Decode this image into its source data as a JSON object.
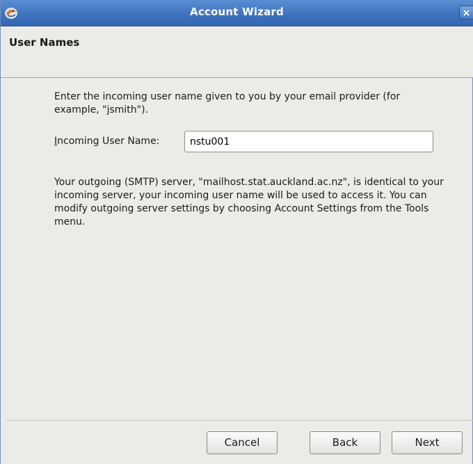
{
  "window": {
    "title": "Account Wizard",
    "close_glyph": "×",
    "app_icon": "thunderbird-icon"
  },
  "page": {
    "title": "User Names"
  },
  "form": {
    "intro_text": "Enter the incoming user name given to you by your email provider (for example, \"jsmith\").",
    "username_label_mnemonic": "I",
    "username_label_rest": "ncoming User Name:",
    "username_value": "nstu001",
    "outgoing_text": "Your outgoing (SMTP) server, \"mailhost.stat.auckland.ac.nz\", is identical to your incoming server, your incoming user name will be used to access it. You can modify outgoing server settings by choosing Account Settings from the Tools menu."
  },
  "buttons": {
    "cancel_label": "Cancel",
    "back_label": "Back",
    "next_label": "Next"
  },
  "colors": {
    "titlebar": "#3f73be",
    "window_bg": "#edebe8"
  }
}
